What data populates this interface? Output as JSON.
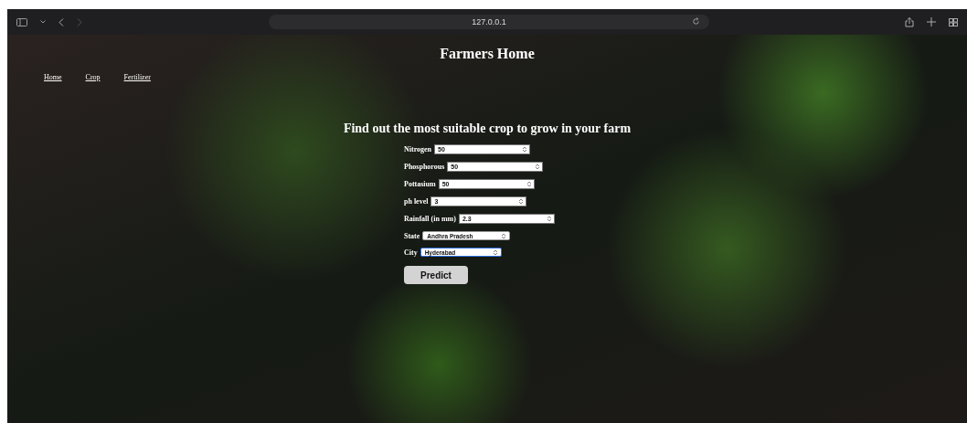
{
  "browser": {
    "url": "127.0.0.1"
  },
  "page": {
    "title": "Farmers Home",
    "nav": [
      {
        "label": "Home"
      },
      {
        "label": "Crop"
      },
      {
        "label": "Fertilizer"
      }
    ],
    "heading": "Find out the most suitable crop to grow in your farm",
    "fields": [
      {
        "kind": "number",
        "label": "Nitrogen",
        "value": "50",
        "focused": false
      },
      {
        "kind": "number",
        "label": "Phosphorous",
        "value": "50",
        "focused": false
      },
      {
        "kind": "number",
        "label": "Pottasium",
        "value": "50",
        "focused": false
      },
      {
        "kind": "number",
        "label": "ph level",
        "value": "3",
        "focused": false
      },
      {
        "kind": "number",
        "label": "Rainfall (in mm)",
        "value": "2.3",
        "focused": false
      },
      {
        "kind": "select",
        "label": "State",
        "value": "Andhra Pradesh",
        "focused": false
      },
      {
        "kind": "select",
        "label": "City",
        "value": "Hyderabad",
        "focused": true
      }
    ],
    "submit": "Predict"
  }
}
